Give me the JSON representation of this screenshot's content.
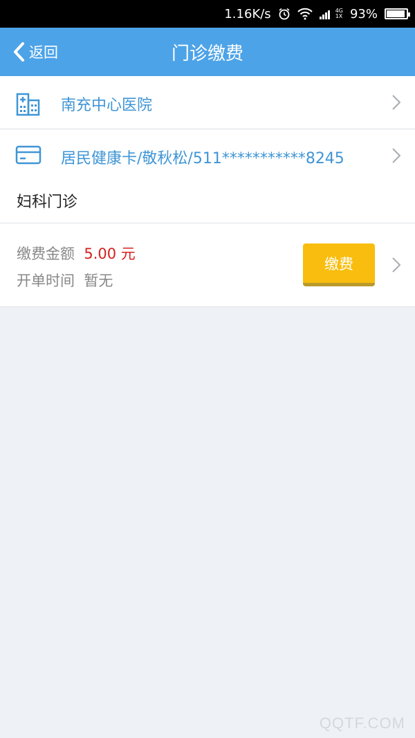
{
  "status_bar": {
    "speed": "1.16K/s",
    "network": "4G",
    "network_sub": "1X",
    "battery": "93%",
    "battery_level": 0.93
  },
  "header": {
    "back_label": "返回",
    "title": "门诊缴费"
  },
  "hospital": {
    "name": "南充中心医院",
    "icon": "hospital-icon"
  },
  "card_info": {
    "text": "居民健康卡/敬秋松/511***********8245",
    "icon": "id-card-icon"
  },
  "department": "妇科门诊",
  "fee": {
    "amount_label": "缴费金额",
    "amount_value": "5.00 元",
    "time_label": "开单时间",
    "time_value": "暂无",
    "pay_button": "缴费"
  },
  "watermark": "QQTF.COM",
  "colors": {
    "header_bg": "#4da3e8",
    "accent_text": "#3f95d6",
    "amount_red": "#d62020",
    "pay_button": "#f8bd0e"
  }
}
